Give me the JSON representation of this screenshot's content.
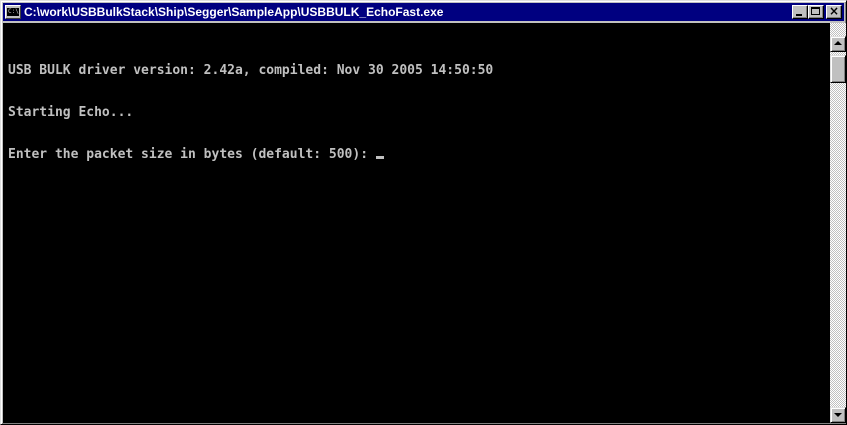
{
  "window": {
    "title": "C:\\work\\USBBulkStack\\Ship\\Segger\\SampleApp\\USBBULK_EchoFast.exe",
    "icon": "console-icon",
    "icon_text": "C:\\",
    "buttons": {
      "minimize": "minimize-icon",
      "maximize": "maximize-icon",
      "close": "×"
    }
  },
  "console": {
    "lines": [
      "USB BULK driver version: 2.42a, compiled: Nov 30 2005 14:50:50",
      "Starting Echo...",
      "Enter the packet size in bytes (default: 500): "
    ],
    "cursor": "text-cursor"
  },
  "colors": {
    "titlebar": "#000080",
    "console_bg": "#000000",
    "console_fg": "#c0c0c0",
    "chrome": "#c0c0c0"
  }
}
